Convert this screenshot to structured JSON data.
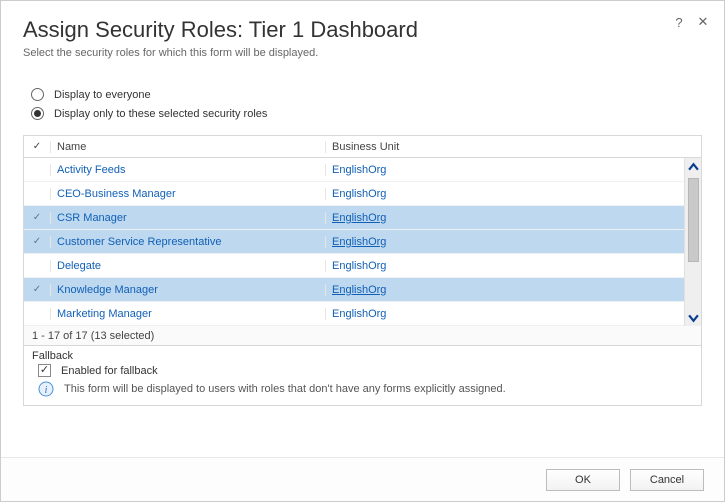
{
  "header": {
    "title": "Assign Security Roles: Tier 1 Dashboard",
    "subtitle": "Select the security roles for which this form will be displayed."
  },
  "radios": {
    "everyone": {
      "label": "Display to everyone",
      "selected": false
    },
    "selected_roles": {
      "label": "Display only to these selected security roles",
      "selected": true
    }
  },
  "table": {
    "columns": {
      "name": "Name",
      "business_unit": "Business Unit"
    },
    "rows": [
      {
        "name": "Activity Feeds",
        "bu": "EnglishOrg",
        "selected": false
      },
      {
        "name": "CEO-Business Manager",
        "bu": "EnglishOrg",
        "selected": false
      },
      {
        "name": "CSR Manager",
        "bu": "EnglishOrg",
        "selected": true
      },
      {
        "name": "Customer Service Representative",
        "bu": "EnglishOrg",
        "selected": true
      },
      {
        "name": "Delegate",
        "bu": "EnglishOrg",
        "selected": false
      },
      {
        "name": "Knowledge Manager",
        "bu": "EnglishOrg",
        "selected": true
      },
      {
        "name": "Marketing Manager",
        "bu": "EnglishOrg",
        "selected": false
      }
    ],
    "status": "1 - 17 of 17 (13 selected)"
  },
  "fallback": {
    "section_label": "Fallback",
    "checkbox_label": "Enabled for fallback",
    "checkbox_checked": true,
    "info": "This form will be displayed to users with roles that don't have any forms explicitly assigned."
  },
  "footer": {
    "ok": "OK",
    "cancel": "Cancel"
  },
  "glyphs": {
    "check": "✓",
    "help": "?",
    "close": "✕"
  }
}
